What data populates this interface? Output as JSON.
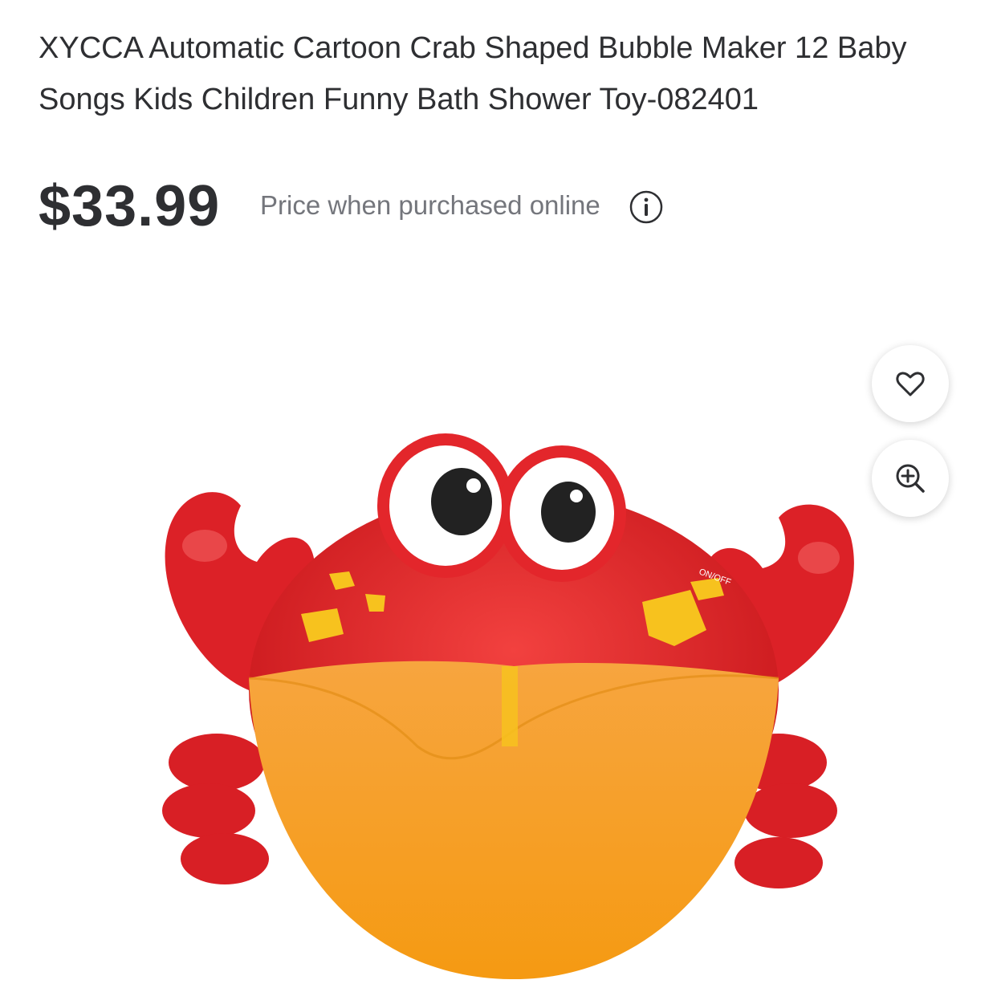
{
  "product": {
    "title": "XYCCA Automatic Cartoon Crab Shaped Bubble Maker 12 Baby Songs Kids Children Funny Bath Shower Toy-082401",
    "price": "$33.99",
    "price_note": "Price when purchased online",
    "image_label_text": "ON/OFF"
  },
  "actions": {
    "favorite_icon": "heart-icon",
    "zoom_icon": "zoom-in-icon"
  },
  "colors": {
    "text_primary": "#2e2f32",
    "text_secondary": "#74767c",
    "crab_red": "#e3262b",
    "crab_orange": "#f5a21c",
    "crab_yellow": "#f7c21e"
  }
}
